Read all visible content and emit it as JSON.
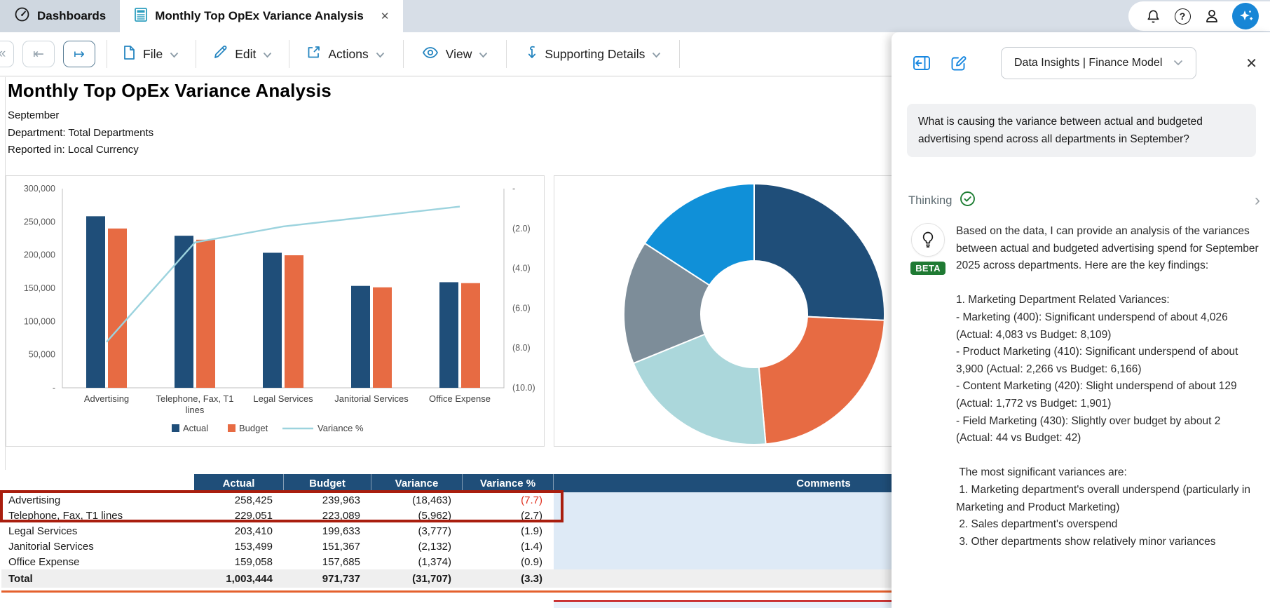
{
  "tabs": {
    "home": {
      "label": "Dashboards",
      "icon": "gauge-icon"
    },
    "active": {
      "label": "Monthly Top OpEx Variance Analysis",
      "icon": "report-icon",
      "close": "✕"
    }
  },
  "topbar_icons": [
    "notifications-bell-icon",
    "help-icon",
    "account-icon",
    "ai-sparkle-icon"
  ],
  "toolbar": {
    "nav": {
      "collapse": "«",
      "back": "⇤",
      "forward": "↦"
    },
    "menus": [
      {
        "label": "File",
        "icon": "file-icon"
      },
      {
        "label": "Edit",
        "icon": "pencil-icon"
      },
      {
        "label": "Actions",
        "icon": "external-action-icon"
      },
      {
        "label": "View",
        "icon": "eye-icon"
      },
      {
        "label": "Supporting Details",
        "icon": "arrow-down-icon"
      }
    ]
  },
  "report": {
    "title": "Monthly Top OpEx Variance Analysis",
    "period": "September",
    "department": "Department: Total Departments",
    "reported_in": "Reported in: Local Currency"
  },
  "chart_data": [
    {
      "type": "bar",
      "subtype": "bar-line-combo",
      "categories": [
        "Advertising",
        "Telephone, Fax, T1 lines",
        "Legal Services",
        "Janitorial Services",
        "Office Expense"
      ],
      "series": [
        {
          "name": "Actual",
          "color": "#1F4E79",
          "values": [
            258425,
            229051,
            203410,
            153499,
            159058
          ]
        },
        {
          "name": "Budget",
          "color": "#E76B43",
          "values": [
            239963,
            223089,
            199633,
            151367,
            157685
          ]
        }
      ],
      "line_series": {
        "name": "Variance %",
        "color": "#9CD3DE",
        "values": [
          -7.7,
          -2.7,
          -1.9,
          -1.4,
          -0.9
        ]
      },
      "ylim": [
        0,
        300000
      ],
      "yticks_left": [
        "-",
        "50,000",
        "100,000",
        "150,000",
        "200,000",
        "250,000",
        "300,000"
      ],
      "right_ylim": [
        0,
        -10
      ],
      "yticks_right": [
        "-",
        "(2.0)",
        "(4.0)",
        "(6.0)",
        "(8.0)",
        "(10.0)"
      ],
      "legend": [
        "Actual",
        "Budget",
        "Variance %"
      ],
      "legend_position": "bottom",
      "grid": false
    },
    {
      "type": "pie",
      "subtype": "donut",
      "categories": [
        "Advertising",
        "Telephone, Fax, T1 lines",
        "Legal Services",
        "Janitorial Services",
        "Office Expense"
      ],
      "values": [
        258425,
        229051,
        203410,
        153499,
        159058
      ],
      "colors": [
        "#1F4E79",
        "#E76B43",
        "#ABD7DB",
        "#7D8D99",
        "#1090D8"
      ],
      "legend_position": "none"
    }
  ],
  "table": {
    "columns": [
      "",
      "Actual",
      "Budget",
      "Variance",
      "Variance %",
      "Comments"
    ],
    "rows": [
      {
        "label": "Advertising",
        "actual": "258,425",
        "budget": "239,963",
        "variance": "(18,463)",
        "variance_pct": "(7.7)",
        "variance_pct_red": true,
        "highlighted": true,
        "comment": ""
      },
      {
        "label": "Telephone, Fax, T1 lines",
        "actual": "229,051",
        "budget": "223,089",
        "variance": "(5,962)",
        "variance_pct": "(2.7)",
        "variance_pct_red": false,
        "highlighted": false,
        "comment": ""
      },
      {
        "label": "Legal Services",
        "actual": "203,410",
        "budget": "199,633",
        "variance": "(3,777)",
        "variance_pct": "(1.9)",
        "variance_pct_red": false,
        "highlighted": false,
        "comment": ""
      },
      {
        "label": "Janitorial Services",
        "actual": "153,499",
        "budget": "151,367",
        "variance": "(2,132)",
        "variance_pct": "(1.4)",
        "variance_pct_red": false,
        "highlighted": false,
        "comment": ""
      },
      {
        "label": "Office Expense",
        "actual": "159,058",
        "budget": "157,685",
        "variance": "(1,374)",
        "variance_pct": "(0.9)",
        "variance_pct_red": false,
        "highlighted": false,
        "comment": ""
      }
    ],
    "total": {
      "label": "Total",
      "actual": "1,003,444",
      "budget": "971,737",
      "variance": "(31,707)",
      "variance_pct": "(3.3)",
      "comment": ""
    }
  },
  "assistant": {
    "selector_label": "Data Insights | Finance Model",
    "close": "✕",
    "question": "What is causing the variance between actual and budgeted advertising spend across all departments in September?",
    "thinking_label": "Thinking",
    "thinking_chevron": "›",
    "beta_label": "BETA",
    "answer": "Based on the data, I can provide an analysis of the variances between actual and budgeted advertising spend for September 2025 across departments. Here are the key findings:\n\n1. Marketing Department Related Variances:\n- Marketing (400): Significant underspend of about 4,026 (Actual: 4,083 vs Budget: 8,109)\n- Product Marketing (410): Significant underspend of about 3,900 (Actual: 2,266 vs Budget: 6,166)\n- Content Marketing (420): Slight underspend of about 129 (Actual: 1,772 vs Budget: 1,901)\n- Field Marketing (430): Slightly over budget by about 2 (Actual: 44 vs Budget: 42)\n\n The most significant variances are:\n 1. Marketing department's overall underspend (particularly in Marketing and Product Marketing)\n 2. Sales department's overspend\n 3. Other departments show relatively minor variances"
  },
  "colors": {
    "header_navy": "#1F4E79",
    "bar_actual": "#1F4E79",
    "bar_budget": "#E76B43",
    "variance_line": "#9CD3DE",
    "highlight_red": "#A91E0E",
    "negative_red": "#E0301E",
    "comment_blue": "#DEEAF6",
    "total_gray": "#EFEFEF",
    "underline_orange": "#E4612E",
    "tabbar_bg": "#d7dee7",
    "accent_blue": "#1787E0",
    "beta_green": "#1F7A33"
  }
}
